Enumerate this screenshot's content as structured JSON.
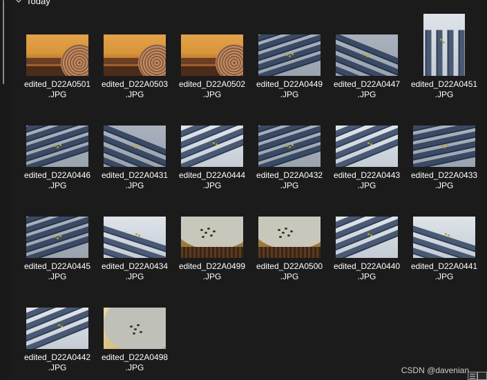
{
  "group": {
    "title": "Today"
  },
  "files": [
    {
      "name_line1": "edited_D22A0501",
      "name_line2": ".JPG",
      "thumb": "amber"
    },
    {
      "name_line1": "edited_D22A0503",
      "name_line2": ".JPG",
      "thumb": "amber"
    },
    {
      "name_line1": "edited_D22A0502",
      "name_line2": ".JPG",
      "thumb": "amber"
    },
    {
      "name_line1": "edited_D22A0449",
      "name_line2": ".JPG",
      "thumb": "bench"
    },
    {
      "name_line1": "edited_D22A0447",
      "name_line2": ".JPG",
      "thumb": "bench"
    },
    {
      "name_line1": "edited_D22A0451",
      "name_line2": ".JPG",
      "thumb": "portrait"
    },
    {
      "name_line1": "edited_D22A0446",
      "name_line2": ".JPG",
      "thumb": "bench"
    },
    {
      "name_line1": "edited_D22A0431",
      "name_line2": ".JPG",
      "thumb": "bench"
    },
    {
      "name_line1": "edited_D22A0444",
      "name_line2": ".JPG",
      "thumb": "light"
    },
    {
      "name_line1": "edited_D22A0432",
      "name_line2": ".JPG",
      "thumb": "bench"
    },
    {
      "name_line1": "edited_D22A0443",
      "name_line2": ".JPG",
      "thumb": "light"
    },
    {
      "name_line1": "edited_D22A0433",
      "name_line2": ".JPG",
      "thumb": "bench"
    },
    {
      "name_line1": "edited_D22A0445",
      "name_line2": ".JPG",
      "thumb": "bench"
    },
    {
      "name_line1": "edited_D22A0434",
      "name_line2": ".JPG",
      "thumb": "light"
    },
    {
      "name_line1": "edited_D22A0499",
      "name_line2": ".JPG",
      "thumb": "plate"
    },
    {
      "name_line1": "edited_D22A0500",
      "name_line2": ".JPG",
      "thumb": "plate"
    },
    {
      "name_line1": "edited_D22A0440",
      "name_line2": ".JPG",
      "thumb": "light"
    },
    {
      "name_line1": "edited_D22A0441",
      "name_line2": ".JPG",
      "thumb": "light"
    },
    {
      "name_line1": "edited_D22A0442",
      "name_line2": ".JPG",
      "thumb": "light"
    },
    {
      "name_line1": "edited_D22A0498",
      "name_line2": ".JPG",
      "thumb": "plate2"
    }
  ],
  "watermark": "CSDN @davenian",
  "colors": {
    "background": "#1b1b1b",
    "text": "#ffffff"
  },
  "icons": {
    "group_toggle": "chevron-down-icon",
    "view_details": "details-view-icon",
    "view_tiles": "large-icons-view-icon"
  }
}
